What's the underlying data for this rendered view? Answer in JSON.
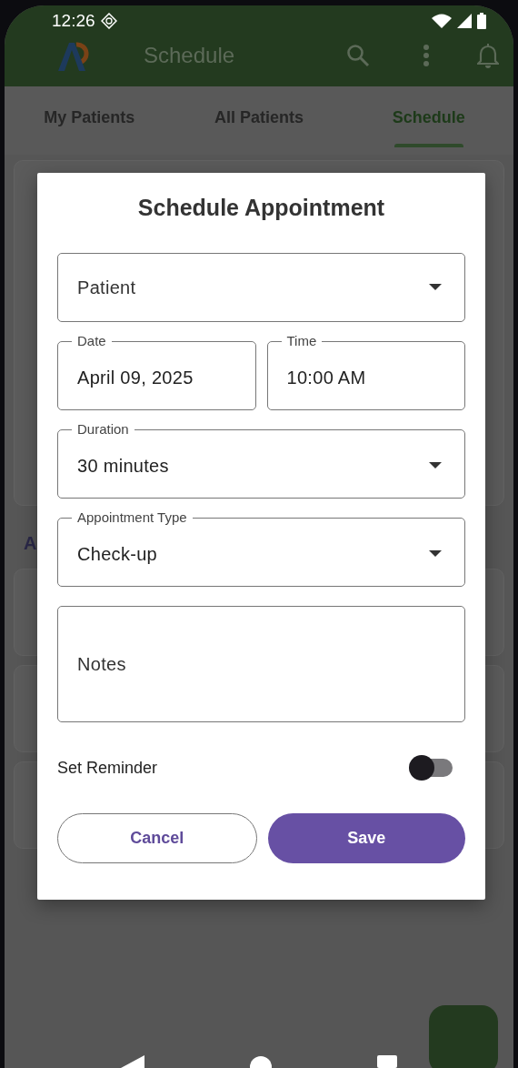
{
  "status_bar": {
    "time": "12:26"
  },
  "app_bar": {
    "title": "Schedule"
  },
  "tabs": [
    {
      "label": "My Patients",
      "selected": false
    },
    {
      "label": "All Patients",
      "selected": false
    },
    {
      "label": "Schedule",
      "selected": true
    }
  ],
  "background": {
    "section_heading": "A"
  },
  "dialog": {
    "title": "Schedule Appointment",
    "fields": [
      [
        {
          "label": "Patient",
          "kind": "select"
        }
      ],
      [
        {
          "label": "Date",
          "value": "April 09, 2025",
          "kind": "text"
        },
        {
          "label": "Time",
          "value": "10:00 AM",
          "kind": "text"
        }
      ],
      [
        {
          "label": "Duration",
          "value": "30 minutes",
          "kind": "select"
        }
      ],
      [
        {
          "label": "Appointment Type",
          "value": "Check-up",
          "kind": "select"
        }
      ],
      [
        {
          "label": "Notes",
          "kind": "multiline"
        }
      ]
    ],
    "reminder": {
      "label": "Set Reminder",
      "on": false
    },
    "buttons": [
      {
        "label": "Cancel",
        "kind": "outlined"
      },
      {
        "label": "Save",
        "kind": "filled"
      }
    ]
  }
}
